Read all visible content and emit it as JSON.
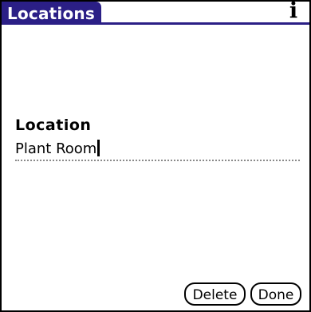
{
  "window": {
    "title": "Locations",
    "info_glyph": "i"
  },
  "form": {
    "label": "Location",
    "value": "Plant Room"
  },
  "buttons": {
    "delete_label": "Delete",
    "done_label": "Done"
  },
  "colors": {
    "title_bar": "#2b1f86",
    "field_underline": "#8a8a8a"
  },
  "icons": {
    "info": "info-icon"
  }
}
